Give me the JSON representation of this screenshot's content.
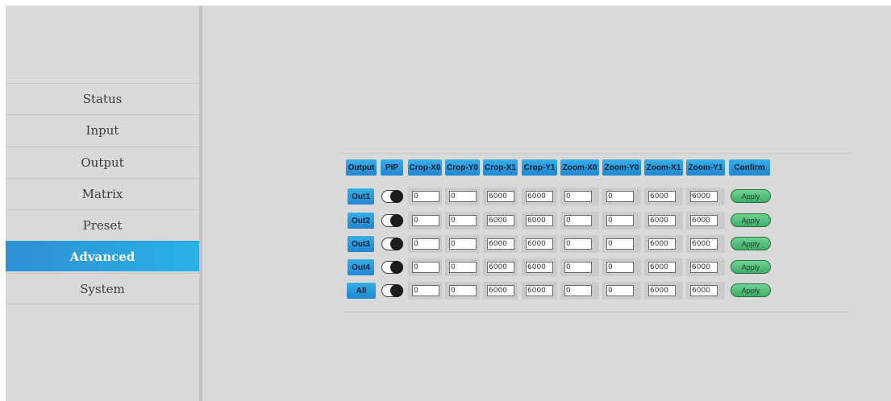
{
  "sidebar": {
    "items": [
      {
        "label": "Status"
      },
      {
        "label": "Input"
      },
      {
        "label": "Output"
      },
      {
        "label": "Matrix"
      },
      {
        "label": "Preset"
      },
      {
        "label": "Advanced",
        "active": true
      },
      {
        "label": "System"
      }
    ]
  },
  "table": {
    "headers": [
      "Output",
      "PIP",
      "Crop-X0",
      "Crop-Y0",
      "Crop-X1",
      "Crop-Y1",
      "Zoom-X0",
      "Zoom-Y0",
      "Zoom-X1",
      "Zoom-Y1",
      "Confirm"
    ],
    "rows": [
      {
        "output": "Out1",
        "pip": true,
        "values": [
          "0",
          "0",
          "6000",
          "6000",
          "0",
          "0",
          "6000",
          "6000"
        ],
        "action": "Apply"
      },
      {
        "output": "Out2",
        "pip": true,
        "values": [
          "0",
          "0",
          "6000",
          "6000",
          "0",
          "0",
          "6000",
          "6000"
        ],
        "action": "Apply"
      },
      {
        "output": "Out3",
        "pip": true,
        "values": [
          "0",
          "0",
          "6000",
          "6000",
          "0",
          "0",
          "6000",
          "6000"
        ],
        "action": "Apply"
      },
      {
        "output": "Out4",
        "pip": true,
        "values": [
          "0",
          "0",
          "6000",
          "6000",
          "0",
          "0",
          "6000",
          "6000"
        ],
        "action": "Apply"
      },
      {
        "output": "All",
        "pip": true,
        "values": [
          "0",
          "0",
          "6000",
          "6000",
          "0",
          "0",
          "6000",
          "6000"
        ],
        "action": "Apply"
      }
    ]
  },
  "colors": {
    "accent": "#27b2e4",
    "apply": "#4cbf77",
    "background": "#d9d9d9"
  }
}
